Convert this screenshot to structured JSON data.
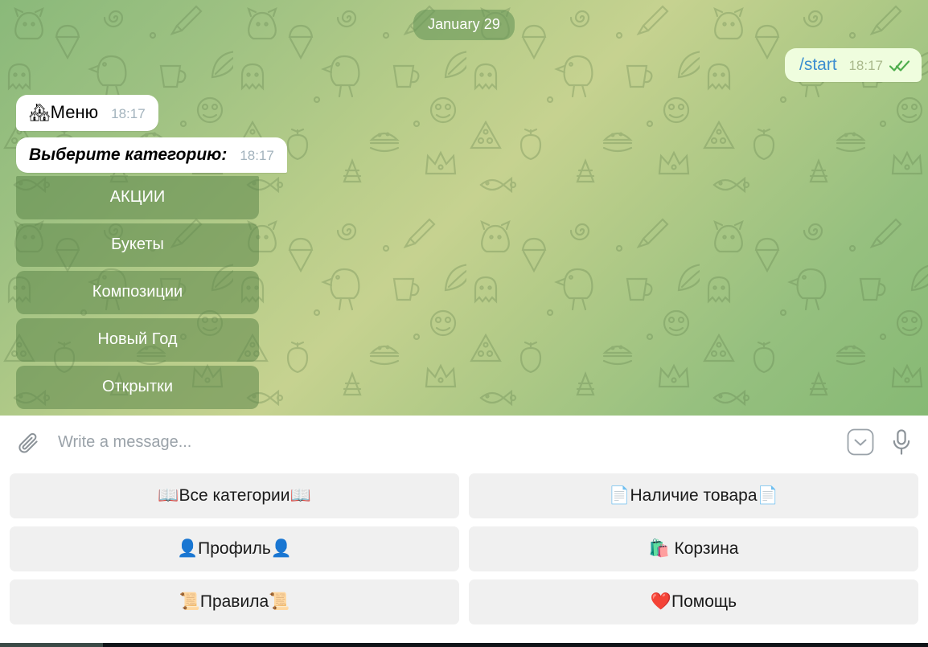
{
  "chat": {
    "date_divider": "January 29",
    "outgoing": {
      "text": "/start",
      "time": "18:17",
      "status_icon": "double-check-icon"
    },
    "incoming": [
      {
        "emoji": "🏘",
        "text": "Меню",
        "time": "18:17"
      },
      {
        "emoji": "",
        "text": "Выберите категорию:",
        "time": "18:17"
      }
    ],
    "inline_keyboard": [
      {
        "label": "АКЦИИ"
      },
      {
        "label": "Букеты"
      },
      {
        "label": "Композиции"
      },
      {
        "label": "Новый Год"
      },
      {
        "label": "Открытки"
      }
    ]
  },
  "composer": {
    "attach_icon": "paperclip-icon",
    "placeholder": "Write a message...",
    "value": "",
    "emoji_icon": "chevron-down-icon",
    "mic_icon": "microphone-icon"
  },
  "reply_keyboard": {
    "rows": [
      [
        {
          "label": "📖Все категории📖"
        },
        {
          "label": "📄Наличие товара📄"
        }
      ],
      [
        {
          "label": "👤Профиль👤"
        },
        {
          "label": "🛍️ Корзина"
        }
      ],
      [
        {
          "label": "📜Правила📜"
        },
        {
          "label": "❤️Помощь"
        }
      ]
    ]
  },
  "colors": {
    "outgoing_bubble": "#effdde",
    "incoming_bubble": "#ffffff",
    "link": "#3c8ed0",
    "check": "#4fae4e",
    "inline_button": "#5d864b",
    "reply_button": "#f0f0f0",
    "chat_bg_from": "#8ab97a",
    "chat_bg_to": "#c6d290"
  }
}
